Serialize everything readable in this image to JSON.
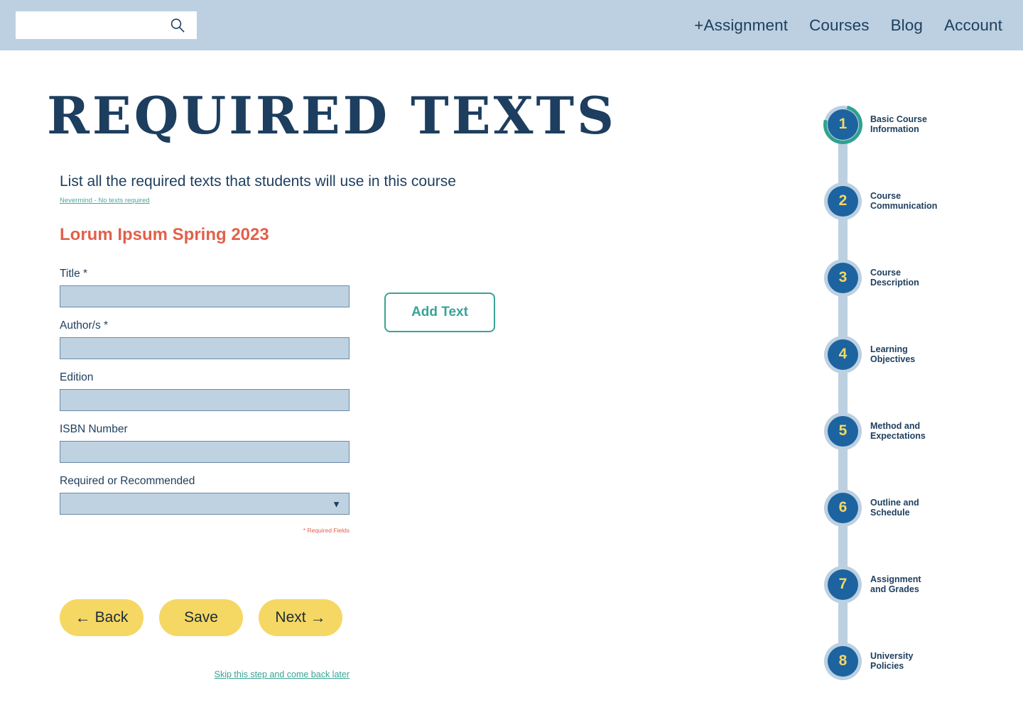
{
  "header": {
    "search": {
      "value": "",
      "placeholder": "",
      "icon": "search-icon"
    },
    "nav": [
      {
        "label": "+Assignment"
      },
      {
        "label": "Courses"
      },
      {
        "label": "Blog"
      },
      {
        "label": "Account"
      }
    ]
  },
  "page": {
    "title": "REQUIRED TEXTS",
    "subtitle": "List all the required texts that students will use in this course",
    "nevermind_link": "Nevermind - No texts required",
    "course_name": "Lorum Ipsum Spring 2023"
  },
  "form": {
    "fields": [
      {
        "label": "Title *",
        "value": "",
        "placeholder": "",
        "type": "text"
      },
      {
        "label": "Author/s *",
        "value": "",
        "placeholder": "",
        "type": "text"
      },
      {
        "label": "Edition",
        "value": "",
        "placeholder": "",
        "type": "text"
      },
      {
        "label": "ISBN Number",
        "value": "",
        "placeholder": "",
        "type": "text"
      },
      {
        "label": "Required or Recommended",
        "value": "",
        "placeholder": "",
        "type": "select"
      }
    ],
    "select_arrow": "▼",
    "required_note": "* Required Fields",
    "add_text_button": "Add Text"
  },
  "actions": {
    "back": "Back",
    "save": "Save",
    "next": "Next",
    "back_arrow": "←",
    "next_arrow": "→",
    "skip_link": "Skip this step and come back later"
  },
  "stepper": {
    "active_step": 1,
    "steps": [
      {
        "number": "1",
        "label": "Basic Course\nInformation"
      },
      {
        "number": "2",
        "label": "Course\nCommunication"
      },
      {
        "number": "3",
        "label": "Course\nDescription"
      },
      {
        "number": "4",
        "label": "Learning\nObjectives"
      },
      {
        "number": "5",
        "label": "Method and\nExpectations"
      },
      {
        "number": "6",
        "label": "Outline and\n Schedule"
      },
      {
        "number": "7",
        "label": "Assignment\nand Grades"
      },
      {
        "number": "8",
        "label": "University\nPolicies"
      }
    ]
  },
  "colors": {
    "header_blue": "#bcd0e1",
    "navy": "#1d3e5e",
    "circle_blue": "#1c63a0",
    "yellow": "#f5d763",
    "teal": "#3aa394",
    "coral": "#e2604a",
    "input_fill": "#bed2e2"
  }
}
